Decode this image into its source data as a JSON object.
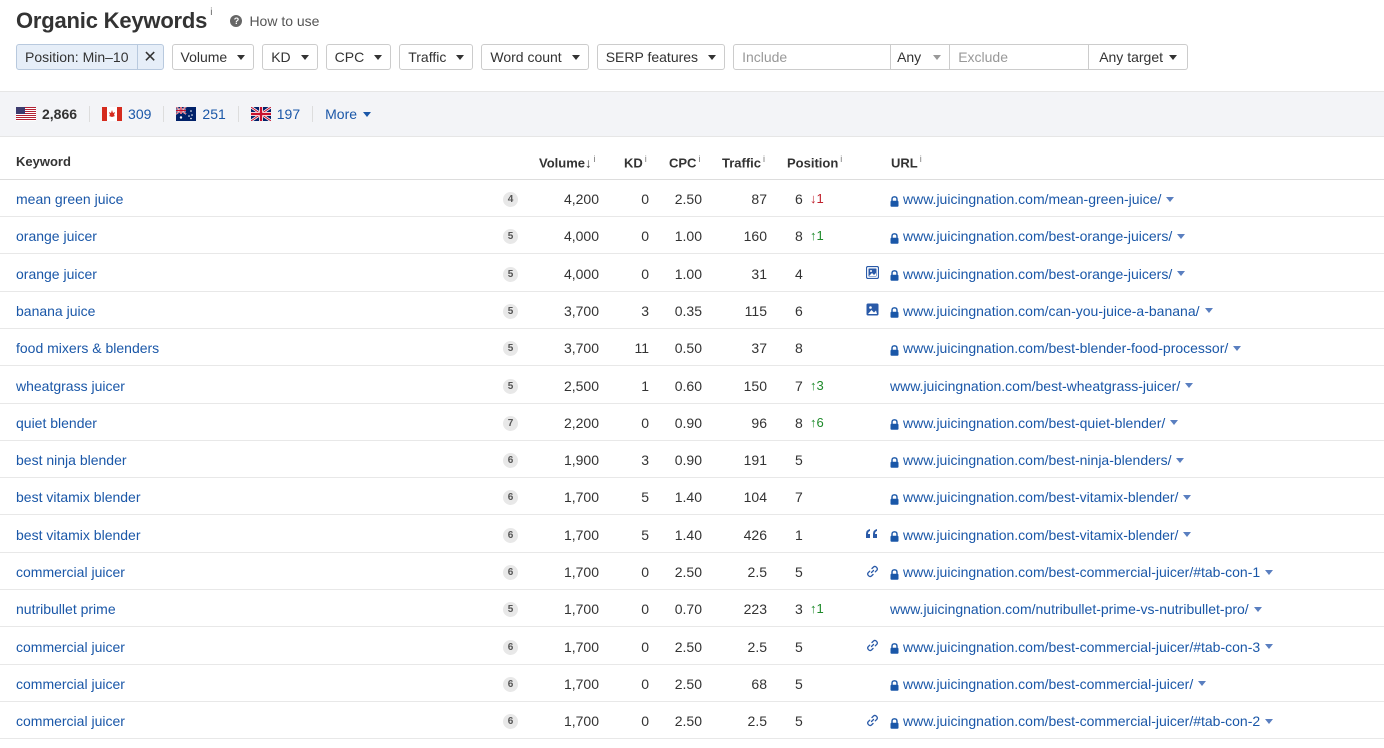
{
  "header": {
    "title": "Organic Keywords",
    "title_info": "i",
    "how_to_use": "How to use"
  },
  "filters": {
    "position": "Position: Min–10",
    "volume": "Volume",
    "kd": "KD",
    "cpc": "CPC",
    "traffic": "Traffic",
    "word_count": "Word count",
    "serp_features": "SERP features",
    "include_placeholder": "Include",
    "include_mode": "Any",
    "exclude_placeholder": "Exclude",
    "target": "Any target"
  },
  "countries": [
    {
      "code": "us",
      "count": "2,866"
    },
    {
      "code": "ca",
      "count": "309"
    },
    {
      "code": "au",
      "count": "251"
    },
    {
      "code": "gb",
      "count": "197"
    }
  ],
  "more_label": "More",
  "columns": {
    "keyword": "Keyword",
    "volume": "Volume",
    "kd": "KD",
    "cpc": "CPC",
    "traffic": "Traffic",
    "position": "Position",
    "url": "URL",
    "info": "i",
    "sort_arrow": "↓"
  },
  "rows": [
    {
      "keyword": "mean green juice",
      "serp": "4",
      "volume": "4,200",
      "kd": "0",
      "cpc": "2.50",
      "traffic": "87",
      "position": "6",
      "change": "1",
      "dir": "down",
      "feature": "",
      "lock": true,
      "url": "www.juicingnation.com/mean-green-juice/"
    },
    {
      "keyword": "orange juicer",
      "serp": "5",
      "volume": "4,000",
      "kd": "0",
      "cpc": "1.00",
      "traffic": "160",
      "position": "8",
      "change": "1",
      "dir": "up",
      "feature": "",
      "lock": true,
      "url": "www.juicingnation.com/best-orange-juicers/"
    },
    {
      "keyword": "orange juicer",
      "serp": "5",
      "volume": "4,000",
      "kd": "0",
      "cpc": "1.00",
      "traffic": "31",
      "position": "4",
      "change": "",
      "dir": "",
      "feature": "image-pack-icon",
      "lock": true,
      "url": "www.juicingnation.com/best-orange-juicers/"
    },
    {
      "keyword": "banana juice",
      "serp": "5",
      "volume": "3,700",
      "kd": "3",
      "cpc": "0.35",
      "traffic": "115",
      "position": "6",
      "change": "",
      "dir": "",
      "feature": "image-icon",
      "lock": true,
      "url": "www.juicingnation.com/can-you-juice-a-banana/"
    },
    {
      "keyword": "food mixers & blenders",
      "serp": "5",
      "volume": "3,700",
      "kd": "11",
      "cpc": "0.50",
      "traffic": "37",
      "position": "8",
      "change": "",
      "dir": "",
      "feature": "",
      "lock": true,
      "url": "www.juicingnation.com/best-blender-food-processor/"
    },
    {
      "keyword": "wheatgrass juicer",
      "serp": "5",
      "volume": "2,500",
      "kd": "1",
      "cpc": "0.60",
      "traffic": "150",
      "position": "7",
      "change": "3",
      "dir": "up",
      "feature": "",
      "lock": false,
      "url": "www.juicingnation.com/best-wheatgrass-juicer/"
    },
    {
      "keyword": "quiet blender",
      "serp": "7",
      "volume": "2,200",
      "kd": "0",
      "cpc": "0.90",
      "traffic": "96",
      "position": "8",
      "change": "6",
      "dir": "up",
      "feature": "",
      "lock": true,
      "url": "www.juicingnation.com/best-quiet-blender/"
    },
    {
      "keyword": "best ninja blender",
      "serp": "6",
      "volume": "1,900",
      "kd": "3",
      "cpc": "0.90",
      "traffic": "191",
      "position": "5",
      "change": "",
      "dir": "",
      "feature": "",
      "lock": true,
      "url": "www.juicingnation.com/best-ninja-blenders/"
    },
    {
      "keyword": "best vitamix blender",
      "serp": "6",
      "volume": "1,700",
      "kd": "5",
      "cpc": "1.40",
      "traffic": "104",
      "position": "7",
      "change": "",
      "dir": "",
      "feature": "",
      "lock": true,
      "url": "www.juicingnation.com/best-vitamix-blender/"
    },
    {
      "keyword": "best vitamix blender",
      "serp": "6",
      "volume": "1,700",
      "kd": "5",
      "cpc": "1.40",
      "traffic": "426",
      "position": "1",
      "change": "",
      "dir": "",
      "feature": "quote-icon",
      "lock": true,
      "url": "www.juicingnation.com/best-vitamix-blender/"
    },
    {
      "keyword": "commercial juicer",
      "serp": "6",
      "volume": "1,700",
      "kd": "0",
      "cpc": "2.50",
      "traffic": "2.5",
      "position": "5",
      "change": "",
      "dir": "",
      "feature": "link-icon",
      "lock": true,
      "url": "www.juicingnation.com/best-commercial-juicer/#tab-con-1"
    },
    {
      "keyword": "nutribullet prime",
      "serp": "5",
      "volume": "1,700",
      "kd": "0",
      "cpc": "0.70",
      "traffic": "223",
      "position": "3",
      "change": "1",
      "dir": "up",
      "feature": "",
      "lock": false,
      "url": "www.juicingnation.com/nutribullet-prime-vs-nutribullet-pro/"
    },
    {
      "keyword": "commercial juicer",
      "serp": "6",
      "volume": "1,700",
      "kd": "0",
      "cpc": "2.50",
      "traffic": "2.5",
      "position": "5",
      "change": "",
      "dir": "",
      "feature": "link-icon",
      "lock": true,
      "url": "www.juicingnation.com/best-commercial-juicer/#tab-con-3"
    },
    {
      "keyword": "commercial juicer",
      "serp": "6",
      "volume": "1,700",
      "kd": "0",
      "cpc": "2.50",
      "traffic": "68",
      "position": "5",
      "change": "",
      "dir": "",
      "feature": "",
      "lock": true,
      "url": "www.juicingnation.com/best-commercial-juicer/"
    },
    {
      "keyword": "commercial juicer",
      "serp": "6",
      "volume": "1,700",
      "kd": "0",
      "cpc": "2.50",
      "traffic": "2.5",
      "position": "5",
      "change": "",
      "dir": "",
      "feature": "link-icon",
      "lock": true,
      "url": "www.juicingnation.com/best-commercial-juicer/#tab-con-2"
    }
  ]
}
